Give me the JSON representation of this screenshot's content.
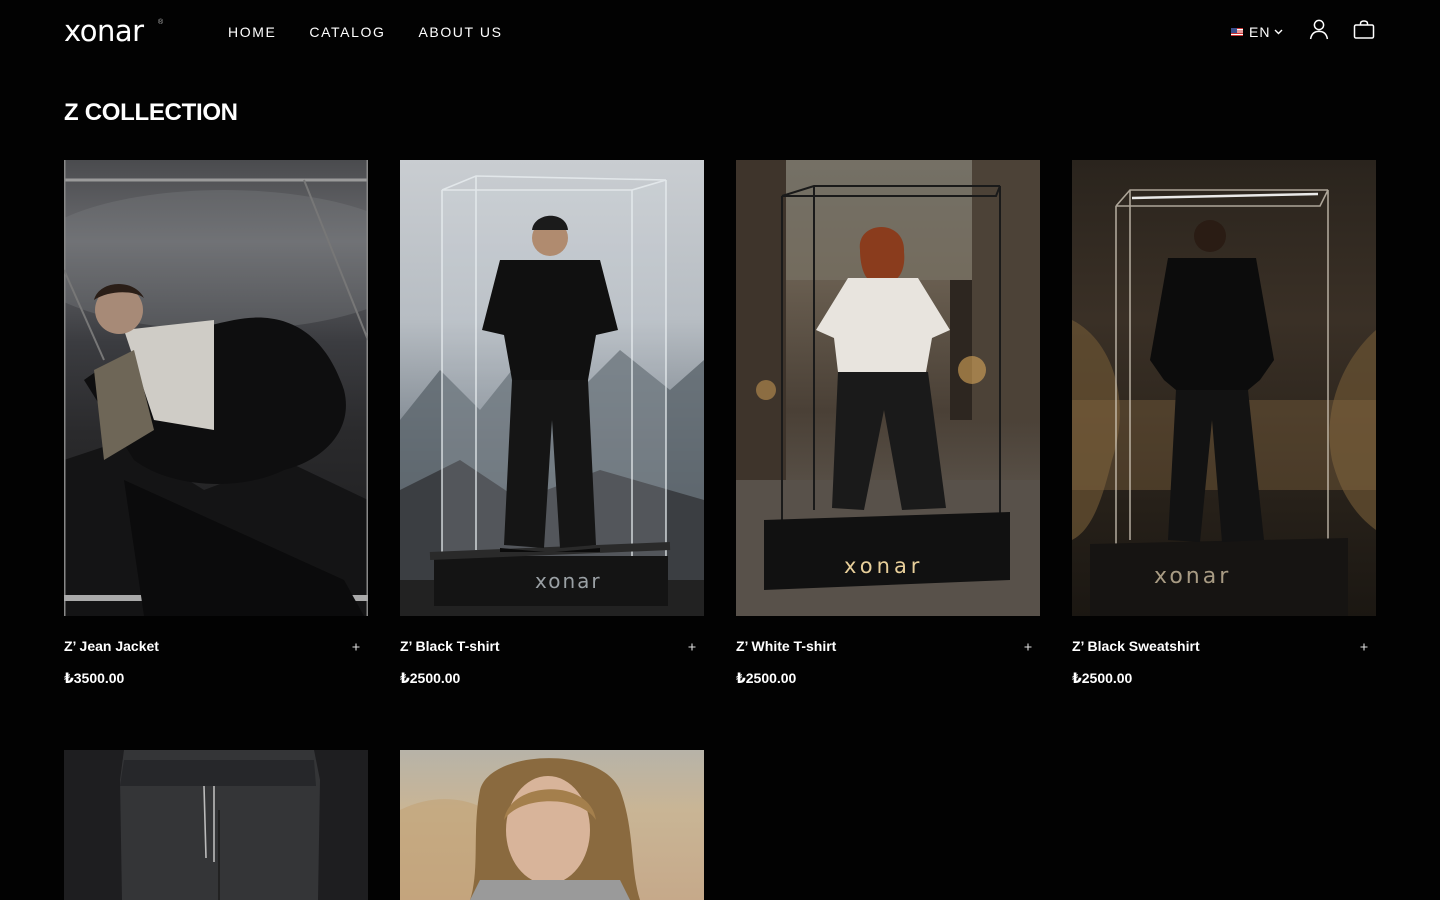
{
  "header": {
    "logo": "xonar",
    "logo_mark": "®",
    "nav": [
      "HOME",
      "CATALOG",
      "ABOUT US"
    ],
    "language": "EN",
    "icons": [
      "flag-icon",
      "chevron-down-icon",
      "user-icon",
      "shopping-bag-icon"
    ]
  },
  "page": {
    "title": "Z COLLECTION"
  },
  "products": [
    {
      "name": "Z’ Jean Jacket",
      "price": "₺3500.00"
    },
    {
      "name": "Z’ Black T-shirt",
      "price": "₺2500.00"
    },
    {
      "name": "Z’ White T-shirt",
      "price": "₺2500.00"
    },
    {
      "name": "Z’ Black Sweatshirt",
      "price": "₺2500.00"
    }
  ],
  "plinth_labels": [
    "xonar",
    "xonar",
    "xonar"
  ]
}
